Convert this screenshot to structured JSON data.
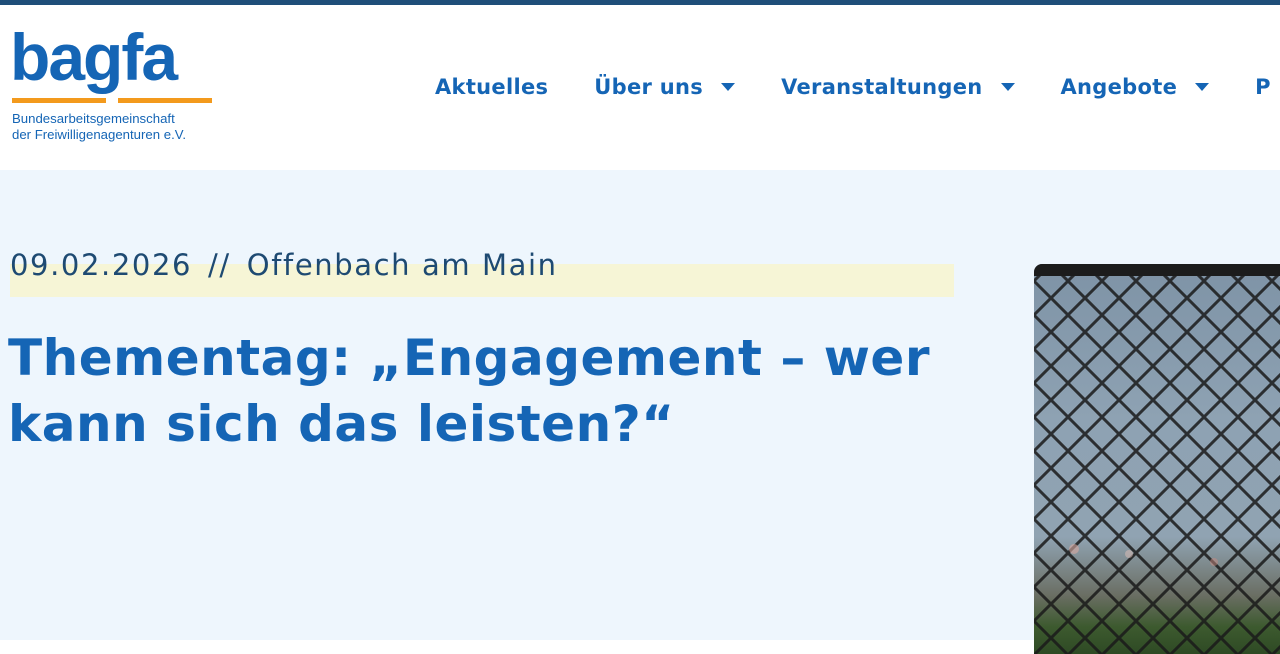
{
  "logo": {
    "wordmark": "bagfa",
    "subtitle_line1": "Bundesarbeitsgemeinschaft",
    "subtitle_line2": "der Freiwilligenagenturen e.V."
  },
  "nav": {
    "items": [
      {
        "label": "Aktuelles",
        "has_dropdown": false
      },
      {
        "label": "Über uns",
        "has_dropdown": true
      },
      {
        "label": "Veranstaltungen",
        "has_dropdown": true
      },
      {
        "label": "Angebote",
        "has_dropdown": true
      },
      {
        "label": "P",
        "has_dropdown": false
      }
    ]
  },
  "event": {
    "date": "09.02.2026",
    "separator": "//",
    "location": "Offenbach am Main",
    "title": "Thementag: „Engagement – wer kann sich das leisten?“"
  },
  "colors": {
    "brand_blue": "#1565b5",
    "accent_orange": "#f39a1d",
    "top_bar": "#1f4e79",
    "main_bg": "#eef6fd",
    "highlight": "#f6f5d6"
  },
  "icons": {
    "dropdown": "chevron-down-icon",
    "image": "chain-link-fence-photo"
  }
}
